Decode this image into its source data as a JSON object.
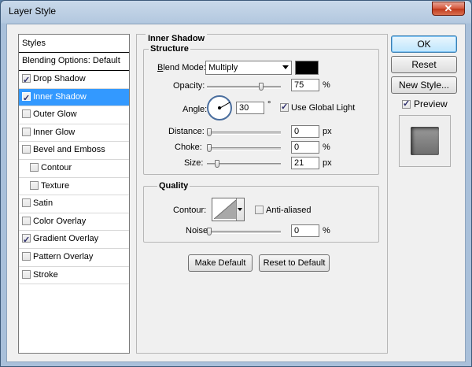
{
  "window": {
    "title": "Layer Style",
    "close_glyph": "✕"
  },
  "styles_panel": {
    "header": "Styles",
    "blending_options": "Blending Options: Default",
    "items": [
      {
        "label": "Drop Shadow",
        "checked": true,
        "selected": false,
        "indent": false
      },
      {
        "label": "Inner Shadow",
        "checked": true,
        "selected": true,
        "indent": false
      },
      {
        "label": "Outer Glow",
        "checked": false,
        "selected": false,
        "indent": false
      },
      {
        "label": "Inner Glow",
        "checked": false,
        "selected": false,
        "indent": false
      },
      {
        "label": "Bevel and Emboss",
        "checked": false,
        "selected": false,
        "indent": false
      },
      {
        "label": "Contour",
        "checked": false,
        "selected": false,
        "indent": true
      },
      {
        "label": "Texture",
        "checked": false,
        "selected": false,
        "indent": true
      },
      {
        "label": "Satin",
        "checked": false,
        "selected": false,
        "indent": false
      },
      {
        "label": "Color Overlay",
        "checked": false,
        "selected": false,
        "indent": false
      },
      {
        "label": "Gradient Overlay",
        "checked": true,
        "selected": false,
        "indent": false
      },
      {
        "label": "Pattern Overlay",
        "checked": false,
        "selected": false,
        "indent": false
      },
      {
        "label": "Stroke",
        "checked": false,
        "selected": false,
        "indent": false
      }
    ]
  },
  "inner_shadow": {
    "title": "Inner Shadow",
    "structure": {
      "title": "Structure",
      "blend_mode_label": "Blend Mode:",
      "blend_mode_value": "Multiply",
      "shadow_color": "#000000",
      "opacity_label": "Opacity:",
      "opacity_value": "75",
      "opacity_level": 0.75,
      "opacity_unit": "%",
      "angle_label": "Angle:",
      "angle_value": "30",
      "angle_unit": "°",
      "use_global_light_label": "Use Global Light",
      "use_global_light": true,
      "distance_label": "Distance:",
      "distance_value": "0",
      "distance_unit": "px",
      "choke_label": "Choke:",
      "choke_value": "0",
      "choke_unit": "%",
      "size_label": "Size:",
      "size_value": "21",
      "size_unit": "px"
    },
    "quality": {
      "title": "Quality",
      "contour_label": "Contour:",
      "anti_aliased_label": "Anti-aliased",
      "anti_aliased": false,
      "noise_label": "Noise:",
      "noise_value": "0",
      "noise_unit": "%"
    },
    "make_default_label": "Make Default",
    "reset_default_label": "Reset to Default"
  },
  "actions": {
    "ok_label": "OK",
    "reset_label": "Reset",
    "new_style_label": "New Style...",
    "preview_label": "Preview",
    "preview_checked": true
  },
  "colors": {
    "selection": "#3399ff",
    "title_bar": "#b3c8df",
    "close_button": "#c8452a"
  }
}
